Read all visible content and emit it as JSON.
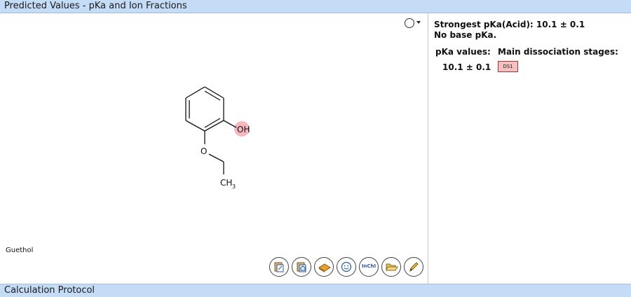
{
  "header": {
    "title": "Predicted Values - pKa and Ion Fractions"
  },
  "footer": {
    "title": "Calculation Protocol"
  },
  "structure": {
    "compound_name": "Guethol",
    "atom_labels": {
      "oh": "OH",
      "o": "O",
      "ch3_main": "CH",
      "ch3_sub": "3"
    },
    "highlight_color": "#f5b8bf"
  },
  "toolbar": {
    "buttons": [
      {
        "name": "copy-image-button",
        "icon": "clipboard-image-icon"
      },
      {
        "name": "copy-molfile-button",
        "icon": "clipboard-copy-icon"
      },
      {
        "name": "open-book-button",
        "icon": "book-icon"
      },
      {
        "name": "smiles-button",
        "icon": "smiley-icon"
      },
      {
        "name": "inchi-button",
        "icon": "inchi-icon",
        "label": "InChI"
      },
      {
        "name": "open-file-button",
        "icon": "folder-open-icon"
      },
      {
        "name": "edit-structure-button",
        "icon": "pencil-icon"
      }
    ]
  },
  "results": {
    "strongest_pka": "Strongest pKa(Acid): 10.1 ± 0.1",
    "no_base": "No base pKa.",
    "pka_values_header": "pKa values:",
    "stages_header": "Main dissociation stages:",
    "pka_value": "10.1 ± 0.1",
    "stage_badge": "DS1",
    "badge_color": "#f4c0c0"
  }
}
